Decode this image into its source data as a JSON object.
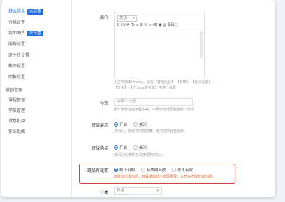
{
  "sidebar": {
    "items": [
      {
        "label": "基本信息",
        "tag": "未完善",
        "active": true
      },
      {
        "label": "价格设置"
      },
      {
        "label": "封面图片",
        "tag": "未设置"
      },
      {
        "label": "服务设置"
      },
      {
        "label": "班主任设置"
      },
      {
        "label": "教师设置"
      },
      {
        "label": "助教设置"
      }
    ],
    "group_label": "营销管理",
    "group_items": [
      {
        "label": "课程管理"
      },
      {
        "label": "学员管理"
      },
      {
        "label": "试卷批阅"
      },
      {
        "label": "作业批阅"
      }
    ]
  },
  "form": {
    "intro_label": "简介",
    "editor": {
      "font_size_label": "大小",
      "toolbar_text": "B I U A· T₂ ≡ ☰ ☷ ∞ ⌫ ▣ ▤ 源码 ⛶",
      "toolbar_source": "源码"
    },
    "intro_hint_line1": "为正常使用iFrame，请在【管理后台】-【系统】-【站点设置】-",
    "intro_hint_line2": "【安全】-【iFrame白名单】中进行设置",
    "tags_label": "标签",
    "tags_placeholder": "请输入标签",
    "tags_hint": "用于按标签检索图书等，由网校管理员后台统一管理",
    "display_label": "班级展示",
    "display_options": [
      "开启",
      "关闭"
    ],
    "display_hint": "关闭后，班级将彻底隐藏，无法在前台查看到。",
    "purchase_label": "班级购买",
    "purchase_options": [
      "开启",
      "关闭"
    ],
    "purchase_hint": "关闭后班级将无法在线购买加入。",
    "validity_label": "班级有效期",
    "validity_options": [
      "截止日期",
      "有效期天数",
      "永久有效"
    ],
    "validity_warning": "班级首次发布后，有效期模式不能再更改，只允许修改有效日期。",
    "category_label": "分类",
    "category_value": "分类"
  },
  "colors": {
    "accent": "#1d6fe8",
    "warning_border": "#e03a3a",
    "warning_text": "#e0663a"
  }
}
